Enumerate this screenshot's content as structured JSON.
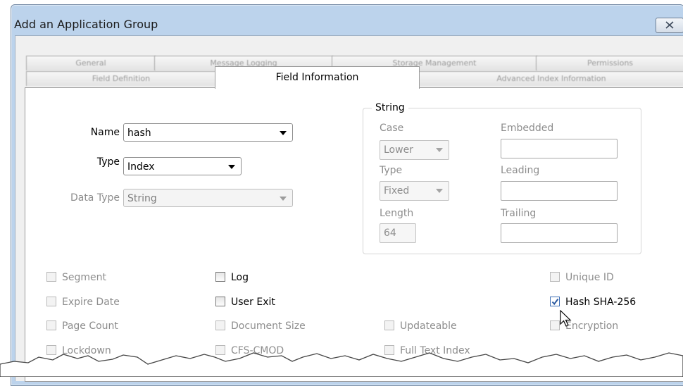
{
  "window": {
    "title": "Add an Application Group"
  },
  "tabs_row1": [
    "General",
    "Message Logging",
    "Storage Management",
    "Permissions"
  ],
  "tabs_row2": [
    "Field Definition",
    "Field Information",
    "Advanced Index Information"
  ],
  "active_tab": "Field Information",
  "fields": {
    "name_label": "Name",
    "name_value": "hash",
    "type_label": "Type",
    "type_value": "Index",
    "data_type_label": "Data Type",
    "data_type_value": "String"
  },
  "string_group": {
    "legend": "String",
    "case_label": "Case",
    "case_value": "Lower",
    "type_label": "Type",
    "type_value": "Fixed",
    "length_label": "Length",
    "length_value": "64",
    "embedded_label": "Embedded",
    "embedded_value": "",
    "leading_label": "Leading",
    "leading_value": "",
    "trailing_label": "Trailing",
    "trailing_value": ""
  },
  "checkboxes": {
    "segment": "Segment",
    "expire_date": "Expire Date",
    "page_count": "Page Count",
    "lockdown": "Lockdown",
    "log": "Log",
    "user_exit": "User Exit",
    "document_size": "Document Size",
    "cfs_cmod": "CFS-CMOD",
    "updateable": "Updateable",
    "full_text_index": "Full Text Index",
    "unique_id": "Unique ID",
    "hash_sha256": "Hash SHA-256",
    "encryption": "Encryption"
  },
  "colors": {
    "window_frame": "#bcd3ec",
    "checkbox_check": "#3b6db4"
  },
  "icons": [
    "close-icon",
    "dropdown-arrow-icon",
    "checkmark-icon",
    "mouse-pointer-icon"
  ]
}
